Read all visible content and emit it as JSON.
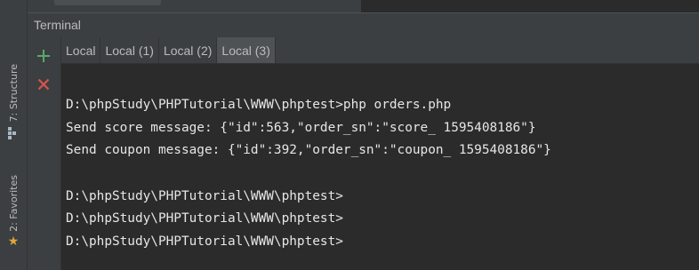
{
  "sidebar": {
    "structure_label": "7: Structure",
    "favorites_label": "2: Favorites"
  },
  "terminal": {
    "title": "Terminal",
    "tabs": [
      {
        "label": "Local",
        "active": false
      },
      {
        "label": "Local (1)",
        "active": false
      },
      {
        "label": "Local (2)",
        "active": false
      },
      {
        "label": "Local (3)",
        "active": true
      }
    ],
    "lines": [
      "D:\\phpStudy\\PHPTutorial\\WWW\\phptest>php orders.php",
      "Send score message: {\"id\":563,\"order_sn\":\"score_ 1595408186\"}",
      "Send coupon message: {\"id\":392,\"order_sn\":\"coupon_ 1595408186\"}",
      "",
      "D:\\phpStudy\\PHPTutorial\\WWW\\phptest>",
      "D:\\phpStudy\\PHPTutorial\\WWW\\phptest>",
      "D:\\phpStudy\\PHPTutorial\\WWW\\phptest>"
    ]
  },
  "icons": {
    "add": "plus-icon",
    "close": "close-icon",
    "structure": "structure-icon",
    "favorites": "star-icon"
  },
  "colors": {
    "add_icon": "#59a869",
    "close_icon": "#d9534f",
    "favorites_star": "#e2a53a",
    "terminal_bg": "#2b2b2b",
    "terminal_text": "#e6e6e6"
  }
}
